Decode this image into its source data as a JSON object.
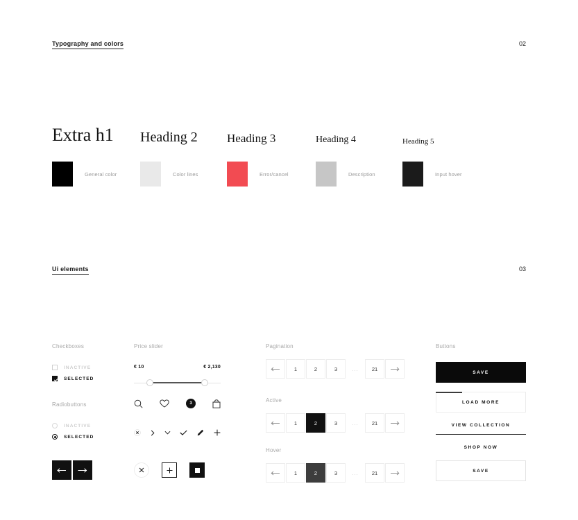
{
  "sections": [
    {
      "title": "Typography and colors",
      "number": "02"
    },
    {
      "title": "Ui elements",
      "number": "03"
    }
  ],
  "typography": [
    {
      "label": "Extra h1",
      "size": "26px"
    },
    {
      "label": "Heading 2",
      "size": "20px"
    },
    {
      "label": "Heading 3",
      "size": "17px"
    },
    {
      "label": "Heading 4",
      "size": "14px"
    },
    {
      "label": "Heading 5",
      "size": "11px"
    }
  ],
  "colors": [
    {
      "name": "General color",
      "hex": "#000000"
    },
    {
      "name": "Color lines",
      "hex": "#E9E9E9"
    },
    {
      "name": "Error/cancel",
      "hex": "#F24B52"
    },
    {
      "name": "Description",
      "hex": "#C6C6C6"
    },
    {
      "name": "Input hover",
      "hex": "#1B1B1B"
    }
  ],
  "checkboxes": {
    "label": "Checkboxes",
    "inactive": "INACTIVE",
    "selected": "SELECTED"
  },
  "radiobuttons": {
    "label": "Radiobuttons",
    "inactive": "INACTIVE",
    "selected": "SELECTED"
  },
  "price_slider": {
    "label": "Price slider",
    "min_value": "€ 10",
    "max_value": "€ 2,130"
  },
  "icons": {
    "primary": [
      "search-icon",
      "heart-icon",
      "cart-badge-icon",
      "bag-icon"
    ],
    "cart_badge_count": "3",
    "secondary": [
      "close-circle-icon",
      "chevron-right-icon",
      "chevron-down-icon",
      "check-icon",
      "pencil-icon",
      "plus-icon"
    ],
    "chips": [
      "close-icon",
      "plus-icon",
      "square-icon"
    ]
  },
  "pagination": {
    "label": "Pagination",
    "active_label": "Active",
    "hover_label": "Hover",
    "pages": [
      "1",
      "2",
      "3"
    ],
    "ellipsis": "...",
    "last_page": "21",
    "prev_icon": "arrow-left-icon",
    "next_icon": "arrow-right-icon",
    "active_page": "2",
    "hover_page": "2"
  },
  "buttons": {
    "label": "Buttons",
    "save_solid": "SAVE",
    "load_more": "LOAD MORE",
    "view_collection": "VIEW COLLECTION",
    "shop_now": "SHOP NOW",
    "save_outline": "SAVE"
  }
}
